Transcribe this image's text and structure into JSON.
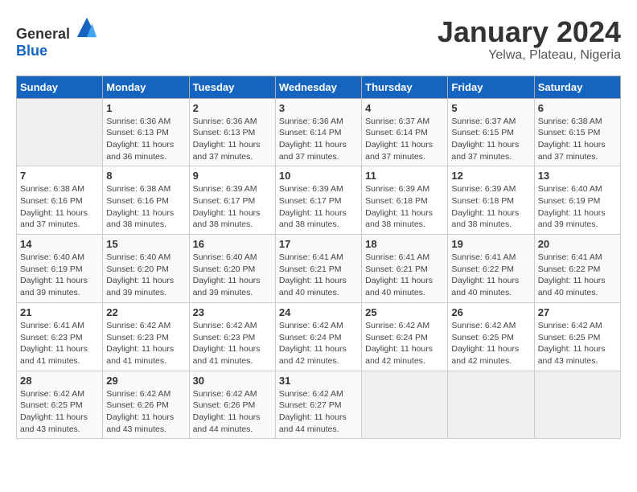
{
  "logo": {
    "text_general": "General",
    "text_blue": "Blue"
  },
  "title": "January 2024",
  "subtitle": "Yelwa, Plateau, Nigeria",
  "headers": [
    "Sunday",
    "Monday",
    "Tuesday",
    "Wednesday",
    "Thursday",
    "Friday",
    "Saturday"
  ],
  "weeks": [
    [
      {
        "day": "",
        "sunrise": "",
        "sunset": "",
        "daylight": ""
      },
      {
        "day": "1",
        "sunrise": "Sunrise: 6:36 AM",
        "sunset": "Sunset: 6:13 PM",
        "daylight": "Daylight: 11 hours and 36 minutes."
      },
      {
        "day": "2",
        "sunrise": "Sunrise: 6:36 AM",
        "sunset": "Sunset: 6:13 PM",
        "daylight": "Daylight: 11 hours and 37 minutes."
      },
      {
        "day": "3",
        "sunrise": "Sunrise: 6:36 AM",
        "sunset": "Sunset: 6:14 PM",
        "daylight": "Daylight: 11 hours and 37 minutes."
      },
      {
        "day": "4",
        "sunrise": "Sunrise: 6:37 AM",
        "sunset": "Sunset: 6:14 PM",
        "daylight": "Daylight: 11 hours and 37 minutes."
      },
      {
        "day": "5",
        "sunrise": "Sunrise: 6:37 AM",
        "sunset": "Sunset: 6:15 PM",
        "daylight": "Daylight: 11 hours and 37 minutes."
      },
      {
        "day": "6",
        "sunrise": "Sunrise: 6:38 AM",
        "sunset": "Sunset: 6:15 PM",
        "daylight": "Daylight: 11 hours and 37 minutes."
      }
    ],
    [
      {
        "day": "7",
        "sunrise": "Sunrise: 6:38 AM",
        "sunset": "Sunset: 6:16 PM",
        "daylight": "Daylight: 11 hours and 37 minutes."
      },
      {
        "day": "8",
        "sunrise": "Sunrise: 6:38 AM",
        "sunset": "Sunset: 6:16 PM",
        "daylight": "Daylight: 11 hours and 38 minutes."
      },
      {
        "day": "9",
        "sunrise": "Sunrise: 6:39 AM",
        "sunset": "Sunset: 6:17 PM",
        "daylight": "Daylight: 11 hours and 38 minutes."
      },
      {
        "day": "10",
        "sunrise": "Sunrise: 6:39 AM",
        "sunset": "Sunset: 6:17 PM",
        "daylight": "Daylight: 11 hours and 38 minutes."
      },
      {
        "day": "11",
        "sunrise": "Sunrise: 6:39 AM",
        "sunset": "Sunset: 6:18 PM",
        "daylight": "Daylight: 11 hours and 38 minutes."
      },
      {
        "day": "12",
        "sunrise": "Sunrise: 6:39 AM",
        "sunset": "Sunset: 6:18 PM",
        "daylight": "Daylight: 11 hours and 38 minutes."
      },
      {
        "day": "13",
        "sunrise": "Sunrise: 6:40 AM",
        "sunset": "Sunset: 6:19 PM",
        "daylight": "Daylight: 11 hours and 39 minutes."
      }
    ],
    [
      {
        "day": "14",
        "sunrise": "Sunrise: 6:40 AM",
        "sunset": "Sunset: 6:19 PM",
        "daylight": "Daylight: 11 hours and 39 minutes."
      },
      {
        "day": "15",
        "sunrise": "Sunrise: 6:40 AM",
        "sunset": "Sunset: 6:20 PM",
        "daylight": "Daylight: 11 hours and 39 minutes."
      },
      {
        "day": "16",
        "sunrise": "Sunrise: 6:40 AM",
        "sunset": "Sunset: 6:20 PM",
        "daylight": "Daylight: 11 hours and 39 minutes."
      },
      {
        "day": "17",
        "sunrise": "Sunrise: 6:41 AM",
        "sunset": "Sunset: 6:21 PM",
        "daylight": "Daylight: 11 hours and 40 minutes."
      },
      {
        "day": "18",
        "sunrise": "Sunrise: 6:41 AM",
        "sunset": "Sunset: 6:21 PM",
        "daylight": "Daylight: 11 hours and 40 minutes."
      },
      {
        "day": "19",
        "sunrise": "Sunrise: 6:41 AM",
        "sunset": "Sunset: 6:22 PM",
        "daylight": "Daylight: 11 hours and 40 minutes."
      },
      {
        "day": "20",
        "sunrise": "Sunrise: 6:41 AM",
        "sunset": "Sunset: 6:22 PM",
        "daylight": "Daylight: 11 hours and 40 minutes."
      }
    ],
    [
      {
        "day": "21",
        "sunrise": "Sunrise: 6:41 AM",
        "sunset": "Sunset: 6:23 PM",
        "daylight": "Daylight: 11 hours and 41 minutes."
      },
      {
        "day": "22",
        "sunrise": "Sunrise: 6:42 AM",
        "sunset": "Sunset: 6:23 PM",
        "daylight": "Daylight: 11 hours and 41 minutes."
      },
      {
        "day": "23",
        "sunrise": "Sunrise: 6:42 AM",
        "sunset": "Sunset: 6:23 PM",
        "daylight": "Daylight: 11 hours and 41 minutes."
      },
      {
        "day": "24",
        "sunrise": "Sunrise: 6:42 AM",
        "sunset": "Sunset: 6:24 PM",
        "daylight": "Daylight: 11 hours and 42 minutes."
      },
      {
        "day": "25",
        "sunrise": "Sunrise: 6:42 AM",
        "sunset": "Sunset: 6:24 PM",
        "daylight": "Daylight: 11 hours and 42 minutes."
      },
      {
        "day": "26",
        "sunrise": "Sunrise: 6:42 AM",
        "sunset": "Sunset: 6:25 PM",
        "daylight": "Daylight: 11 hours and 42 minutes."
      },
      {
        "day": "27",
        "sunrise": "Sunrise: 6:42 AM",
        "sunset": "Sunset: 6:25 PM",
        "daylight": "Daylight: 11 hours and 43 minutes."
      }
    ],
    [
      {
        "day": "28",
        "sunrise": "Sunrise: 6:42 AM",
        "sunset": "Sunset: 6:25 PM",
        "daylight": "Daylight: 11 hours and 43 minutes."
      },
      {
        "day": "29",
        "sunrise": "Sunrise: 6:42 AM",
        "sunset": "Sunset: 6:26 PM",
        "daylight": "Daylight: 11 hours and 43 minutes."
      },
      {
        "day": "30",
        "sunrise": "Sunrise: 6:42 AM",
        "sunset": "Sunset: 6:26 PM",
        "daylight": "Daylight: 11 hours and 44 minutes."
      },
      {
        "day": "31",
        "sunrise": "Sunrise: 6:42 AM",
        "sunset": "Sunset: 6:27 PM",
        "daylight": "Daylight: 11 hours and 44 minutes."
      },
      {
        "day": "",
        "sunrise": "",
        "sunset": "",
        "daylight": ""
      },
      {
        "day": "",
        "sunrise": "",
        "sunset": "",
        "daylight": ""
      },
      {
        "day": "",
        "sunrise": "",
        "sunset": "",
        "daylight": ""
      }
    ]
  ]
}
